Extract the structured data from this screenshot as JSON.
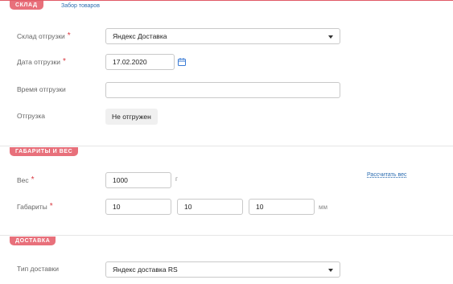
{
  "sections": {
    "warehouse": {
      "badge": "Склад",
      "tab_link": "Забор товаров",
      "fields": {
        "ship_warehouse": {
          "label": "Склад отгрузки",
          "required": "*",
          "value": "Яндекс Доставка",
          "icon": "chevron-down-icon"
        },
        "ship_date": {
          "label": "Дата отгрузки",
          "required": "*",
          "value": "17.02.2020",
          "icon": "calendar-icon"
        },
        "ship_time": {
          "label": "Время отгрузки",
          "value": ""
        },
        "shipment": {
          "label": "Отгрузка",
          "value": "Не отгружен"
        }
      }
    },
    "dimensions": {
      "badge": "Габариты и вес",
      "calc_link": "Рассчитать вес",
      "fields": {
        "weight": {
          "label": "Вес",
          "required": "*",
          "value": "1000",
          "unit": "г"
        },
        "size": {
          "label": "Габариты",
          "required": "*",
          "length": "10",
          "width": "10",
          "height": "10",
          "unit": "мм"
        }
      }
    },
    "delivery": {
      "badge": "Доставка",
      "fields": {
        "delivery_type": {
          "label": "Тип доставки",
          "value": "Яндекс доставка RS",
          "icon": "chevron-down-icon"
        }
      }
    }
  },
  "colors": {
    "accent": "#e8707b",
    "link": "#2b6cb0",
    "required": "#d9383f",
    "calendar_icon": "#3a7bd5"
  }
}
